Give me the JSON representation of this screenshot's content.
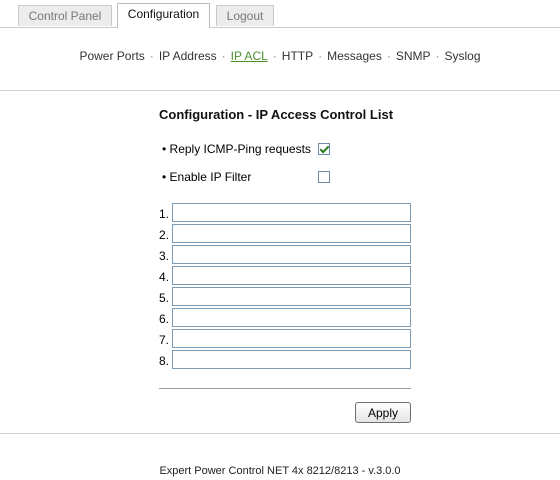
{
  "tabs": {
    "control_panel": "Control Panel",
    "configuration": "Configuration",
    "logout": "Logout"
  },
  "subnav": {
    "items": [
      "Power Ports",
      "IP Address",
      "IP ACL",
      "HTTP",
      "Messages",
      "SNMP",
      "Syslog"
    ],
    "active": "IP ACL"
  },
  "page": {
    "title": "Configuration - IP Access Control List"
  },
  "options": {
    "reply_icmp_label": "• Reply ICMP-Ping requests",
    "reply_icmp_checked": true,
    "enable_filter_label": "• Enable IP Filter",
    "enable_filter_checked": false
  },
  "ip_list": {
    "labels": [
      "1.",
      "2.",
      "3.",
      "4.",
      "5.",
      "6.",
      "7.",
      "8."
    ],
    "values": [
      "",
      "",
      "",
      "",
      "",
      "",
      "",
      ""
    ]
  },
  "apply_label": "Apply",
  "footer": "Expert Power Control NET 4x 8212/8213 - v.3.0.0",
  "colors": {
    "active_link": "#4d8f2c",
    "input_border": "#7b9ab3",
    "checkmark": "#2f7d1e"
  }
}
